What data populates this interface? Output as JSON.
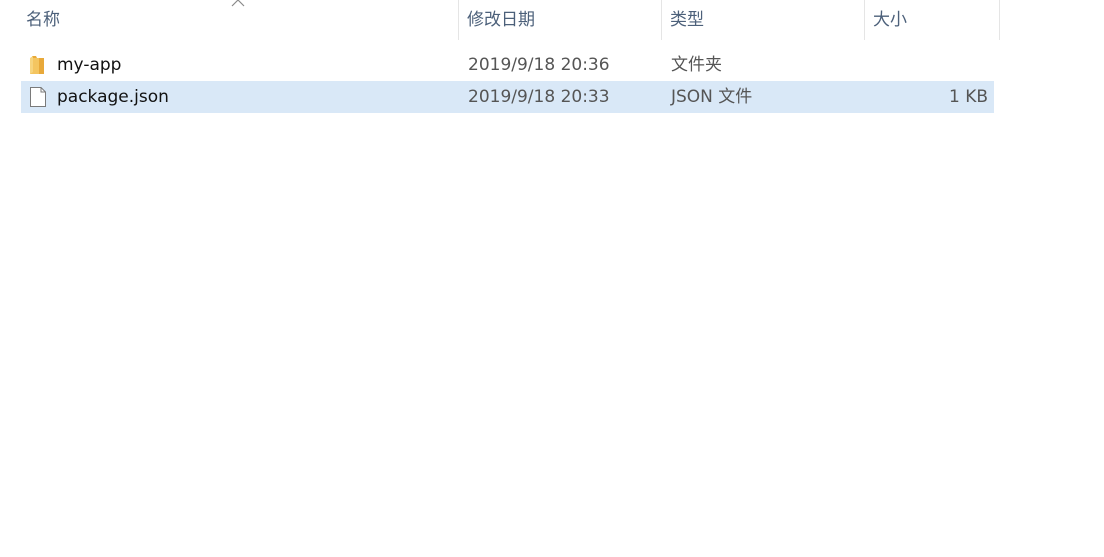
{
  "columns": {
    "name": "名称",
    "date": "修改日期",
    "type": "类型",
    "size": "大小"
  },
  "sort": {
    "column": "name",
    "direction": "ascending",
    "icon": "chevron-up-icon"
  },
  "files": [
    {
      "name": "my-app",
      "date": "2019/9/18 20:36",
      "type": "文件夹",
      "size": "",
      "icon": "folder-icon",
      "selected": false
    },
    {
      "name": "package.json",
      "date": "2019/9/18 20:33",
      "type": "JSON 文件",
      "size": "1 KB",
      "icon": "file-icon",
      "selected": true
    }
  ],
  "colors": {
    "header_text": "#4c607a",
    "selection": "#d9e8f7",
    "folder": "#f4c560"
  }
}
